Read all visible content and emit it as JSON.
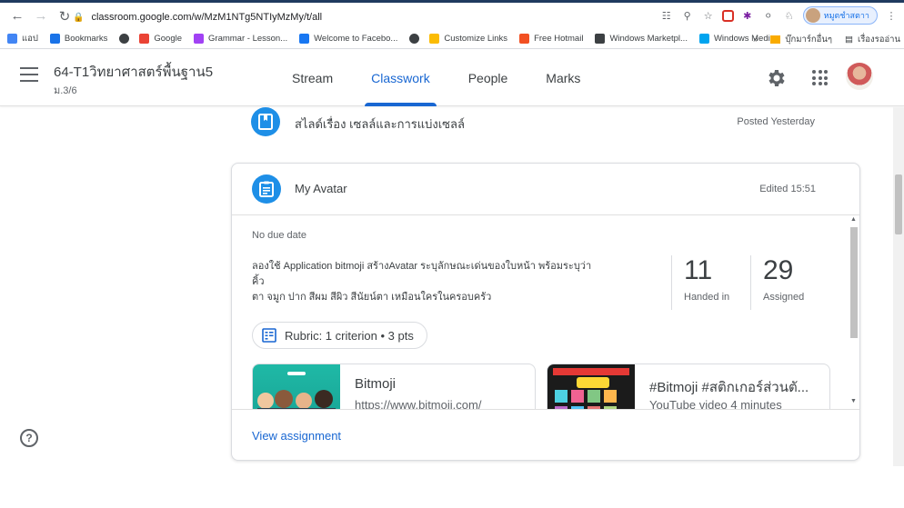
{
  "browser": {
    "url": "classroom.google.com/w/MzM1NTg5NTIyMzMy/t/all",
    "profile_name": "หมูตชำสตาา",
    "bookmarks": [
      {
        "label": "แอป",
        "color": "#4285f4"
      },
      {
        "label": "Bookmarks",
        "color": "#1a73e8"
      },
      {
        "label": "",
        "color": "#3c4043"
      },
      {
        "label": "Google",
        "color": "#ea4335"
      },
      {
        "label": "Grammar - Lesson...",
        "color": "#a142f4"
      },
      {
        "label": "Welcome to Facebo...",
        "color": "#1877f2"
      },
      {
        "label": "",
        "color": "#3c4043"
      },
      {
        "label": "Customize Links",
        "color": "#fbbc04"
      },
      {
        "label": "Free Hotmail",
        "color": "#f25022"
      },
      {
        "label": "Windows Marketpl...",
        "color": "#3c4043"
      },
      {
        "label": "Windows Media",
        "color": "#00a4ef"
      }
    ],
    "bookmarks_overflow": "»",
    "bookmark_folder_1": "บุ๊กมาร์กอื่นๆ",
    "bookmark_folder_2": "เรื่องรออ่าน"
  },
  "header": {
    "class_title": "64-T1วิทยาศาสตร์พื้นฐาน5",
    "class_subtitle": "ม.3/6",
    "tabs": [
      {
        "label": "Stream",
        "active": false
      },
      {
        "label": "Classwork",
        "active": true
      },
      {
        "label": "People",
        "active": false
      },
      {
        "label": "Marks",
        "active": false
      }
    ]
  },
  "previous_post": {
    "title": "สไลด์เรื่อง เซลล์และการแบ่งเซลล์",
    "meta": "Posted Yesterday"
  },
  "assignment": {
    "title": "My Avatar",
    "meta": "Edited 15:51",
    "due": "No due date",
    "description_lines": [
      "ลองใช้ Application bitmoji สร้างAvatar ระบุลักษณะเด่นของใบหน้า พร้อมระบุว่า",
      "คิ้ว",
      "ตา  จมูก ปาก สีผม สีผิว สีนัยน์ตา  เหมือนใครในครอบครัว"
    ],
    "handed_in": {
      "value": "11",
      "label": "Handed in"
    },
    "assigned": {
      "value": "29",
      "label": "Assigned"
    },
    "rubric_label": "Rubric: 1 criterion • 3 pts",
    "attachments": [
      {
        "title": "Bitmoji",
        "subtitle": "https://www.bitmoji.com/"
      },
      {
        "title": "#Bitmoji #สติกเกอร์ส่วนตั...",
        "subtitle": "YouTube video   4 minutes"
      }
    ],
    "view_link": "View assignment"
  },
  "colors": {
    "accent": "#1967d2",
    "icon_blue": "#1e8fe7"
  }
}
